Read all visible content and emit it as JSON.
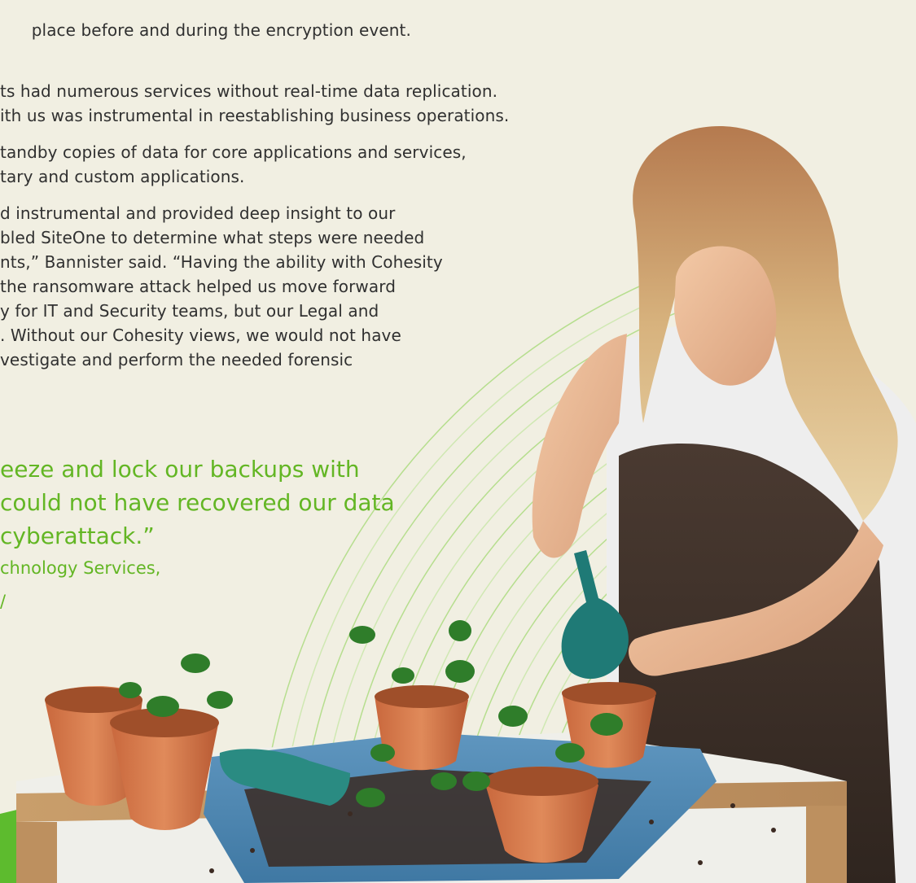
{
  "paragraphs": [
    {
      "lines": [
        "place before and during the encryption event."
      ]
    },
    {
      "lines": [
        "ts had numerous services without real-time data replication.",
        "ith us was instrumental in reestablishing business operations."
      ]
    },
    {
      "lines": [
        "tandby copies of data for core applications and services,",
        "tary and custom applications."
      ]
    },
    {
      "lines": [
        "d instrumental and provided deep insight to our",
        "bled SiteOne to determine what steps were needed",
        "nts,” Bannister said. “Having the ability with Cohesity",
        "the ransomware attack helped us move forward",
        "y for IT and Security teams, but our Legal and",
        ". Without our Cohesity views, we would not have",
        "vestigate and perform the needed forensic"
      ]
    }
  ],
  "quote": {
    "lines": [
      "eeze and lock our backups with",
      "could not have recovered our data",
      "cyberattack.”"
    ]
  },
  "attribution": {
    "lines": [
      "chnology Services,",
      "/"
    ]
  },
  "colors": {
    "background": "#f1efe2",
    "accent_green": "#63b624",
    "text": "#303030"
  }
}
